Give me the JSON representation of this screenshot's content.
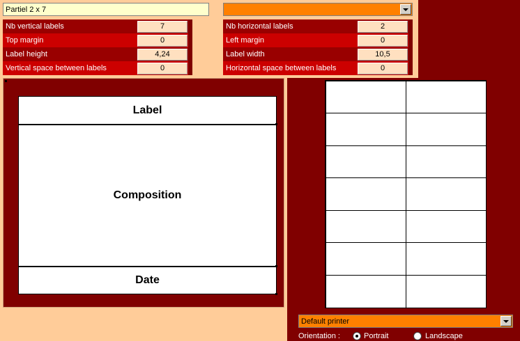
{
  "template_select": {
    "value": "Partiel 2 x 7"
  },
  "model_select": {
    "value": ""
  },
  "left_params": [
    {
      "label": "Nb vertical labels",
      "value": "7"
    },
    {
      "label": "Top margin",
      "value": "0"
    },
    {
      "label": "Label height",
      "value": "4,24"
    },
    {
      "label": "Vertical space between labels",
      "value": "0"
    }
  ],
  "right_params": [
    {
      "label": "Nb horizontal labels",
      "value": "2"
    },
    {
      "label": "Left margin",
      "value": "0"
    },
    {
      "label": "Label width",
      "value": "10,5"
    },
    {
      "label": "Horizontal space between labels",
      "value": "0"
    }
  ],
  "composition": {
    "label_section": "Label",
    "composition_section": "Composition",
    "date_section": "Date"
  },
  "preview_grid": {
    "columns": 2,
    "rows": 7
  },
  "printer": {
    "value": "Default printer"
  },
  "orientation": {
    "label": "Orientation :",
    "portrait": "Portrait",
    "landscape": "Landscape",
    "selected": "Portrait"
  },
  "colors": {
    "maroon": "#800000",
    "row_dark": "#990000",
    "row_red": "#cc0000",
    "peach": "#ffcc99",
    "orange": "#ff8000"
  }
}
